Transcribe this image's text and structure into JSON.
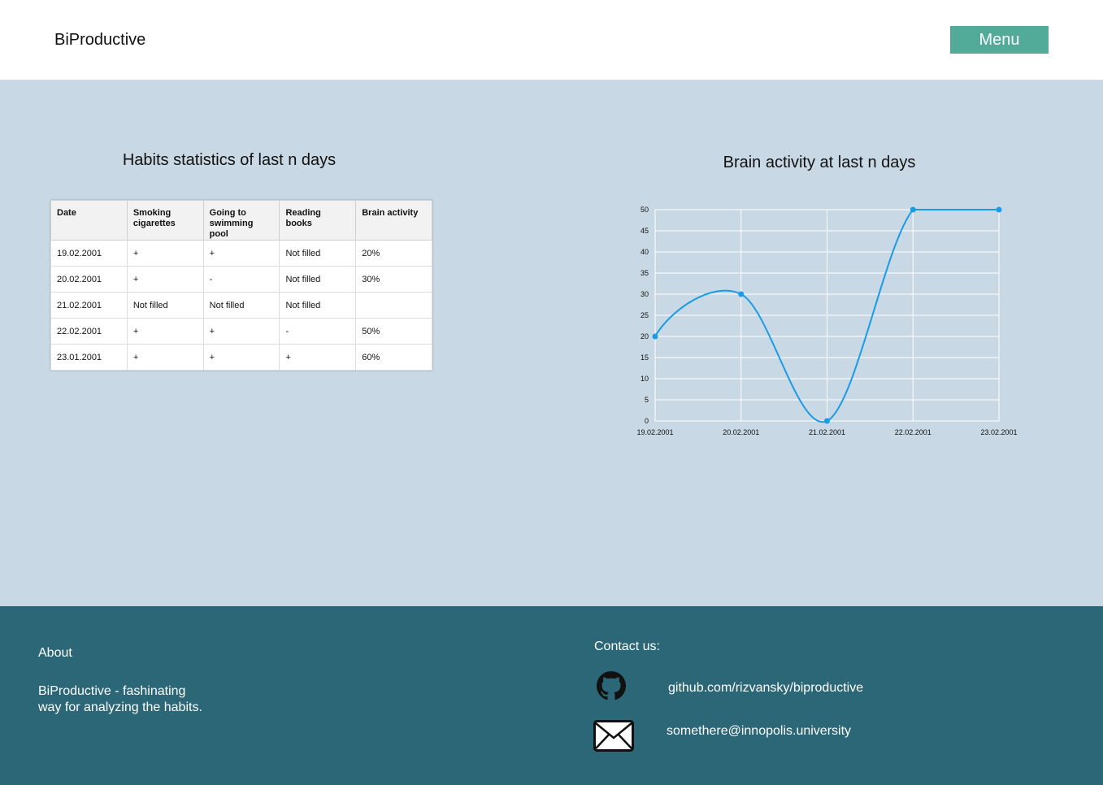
{
  "header": {
    "logo": "BiProductive",
    "menu_label": "Menu"
  },
  "colors": {
    "accent": "#52ab98",
    "footer": "#2b6777",
    "background": "#c8d8e4",
    "line": "#1a9be6"
  },
  "table": {
    "title": "Habits statistics of last n days",
    "headers": [
      "Date",
      "Smoking cigarettes",
      "Going to swimming pool",
      "Reading books",
      "Brain activity"
    ],
    "rows": [
      [
        "19.02.2001",
        "+",
        "+",
        "Not filled",
        "20%"
      ],
      [
        "20.02.2001",
        "+",
        "-",
        "Not filled",
        "30%"
      ],
      [
        "21.02.2001",
        "Not filled",
        "Not filled",
        "Not filled",
        ""
      ],
      [
        "22.02.2001",
        "+",
        "+",
        "-",
        "50%"
      ],
      [
        "23.01.2001",
        "+",
        "+",
        "+",
        "60%"
      ]
    ]
  },
  "chart_data": {
    "type": "line",
    "title": "Brain activity at last n days",
    "xlabel": "",
    "ylabel": "",
    "categories": [
      "19.02.2001",
      "20.02.2001",
      "21.02.2001",
      "22.02.2001",
      "23.02.2001"
    ],
    "values": [
      20,
      30,
      0,
      50,
      50
    ],
    "ylim": [
      0,
      50
    ],
    "yticks": [
      0,
      5,
      10,
      15,
      20,
      25,
      30,
      35,
      40,
      45,
      50
    ],
    "grid": true,
    "smooth": true,
    "color": "#1a9be6"
  },
  "footer": {
    "about_title": "About",
    "about_text": "BiProductive - fashinating way for analyzing the habits.",
    "contact_title": "Contact us:",
    "github_link": "github.com/rizvansky/biproductive",
    "email_link": "somethere@innopolis.university",
    "icons": [
      "github-icon",
      "mail-icon"
    ]
  }
}
